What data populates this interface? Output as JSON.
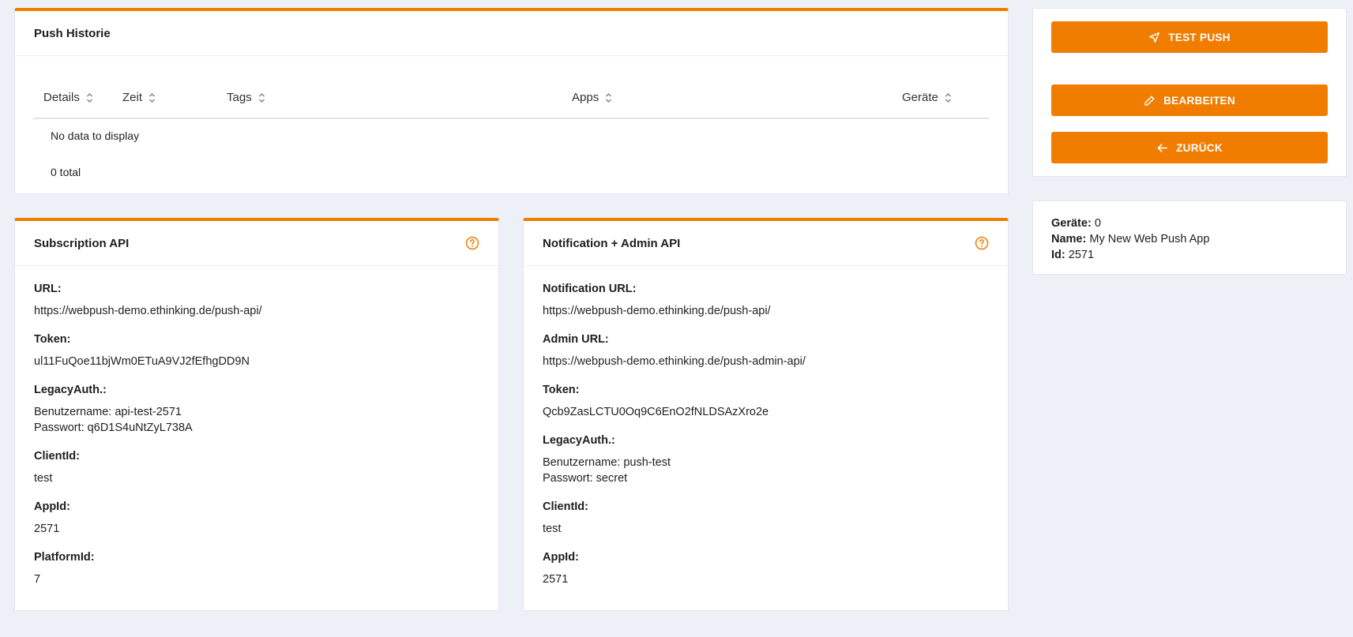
{
  "history": {
    "title": "Push Historie",
    "columns": [
      "Details",
      "Zeit",
      "Tags",
      "Apps",
      "Geräte"
    ],
    "empty_text": "No data to display",
    "total_text": "0 total"
  },
  "subscription": {
    "title": "Subscription API",
    "url_label": "URL:",
    "url": "https://webpush-demo.ethinking.de/push-api/",
    "token_label": "Token:",
    "token": "ul11FuQoe11bjWm0ETuA9VJ2fEfhgDD9N",
    "legacy_label": "LegacyAuth.:",
    "legacy_user": "Benutzername: api-test-2571",
    "legacy_pass": "Passwort: q6D1S4uNtZyL738A",
    "clientid_label": "ClientId:",
    "clientid": "test",
    "appid_label": "AppId:",
    "appid": "2571",
    "platformid_label": "PlatformId:",
    "platformid": "7"
  },
  "notification": {
    "title": "Notification + Admin API",
    "notif_url_label": "Notification URL:",
    "notif_url": "https://webpush-demo.ethinking.de/push-api/",
    "admin_url_label": "Admin URL:",
    "admin_url": "https://webpush-demo.ethinking.de/push-admin-api/",
    "token_label": "Token:",
    "token": "Qcb9ZasLCTU0Oq9C6EnO2fNLDSAzXro2e",
    "legacy_label": "LegacyAuth.:",
    "legacy_user": "Benutzername: push-test",
    "legacy_pass": "Passwort: secret",
    "clientid_label": "ClientId:",
    "clientid": "test",
    "appid_label": "AppId:",
    "appid": "2571"
  },
  "actions": {
    "test_push": "TEST PUSH",
    "edit": "BEARBEITEN",
    "back": "ZURÜCK"
  },
  "app_info": {
    "devices_label": "Geräte:",
    "devices": "0",
    "name_label": "Name:",
    "name": "My New Web Push App",
    "id_label": "Id:",
    "id": "2571"
  },
  "colors": {
    "accent": "#f07d00",
    "background": "#edf0f7"
  }
}
